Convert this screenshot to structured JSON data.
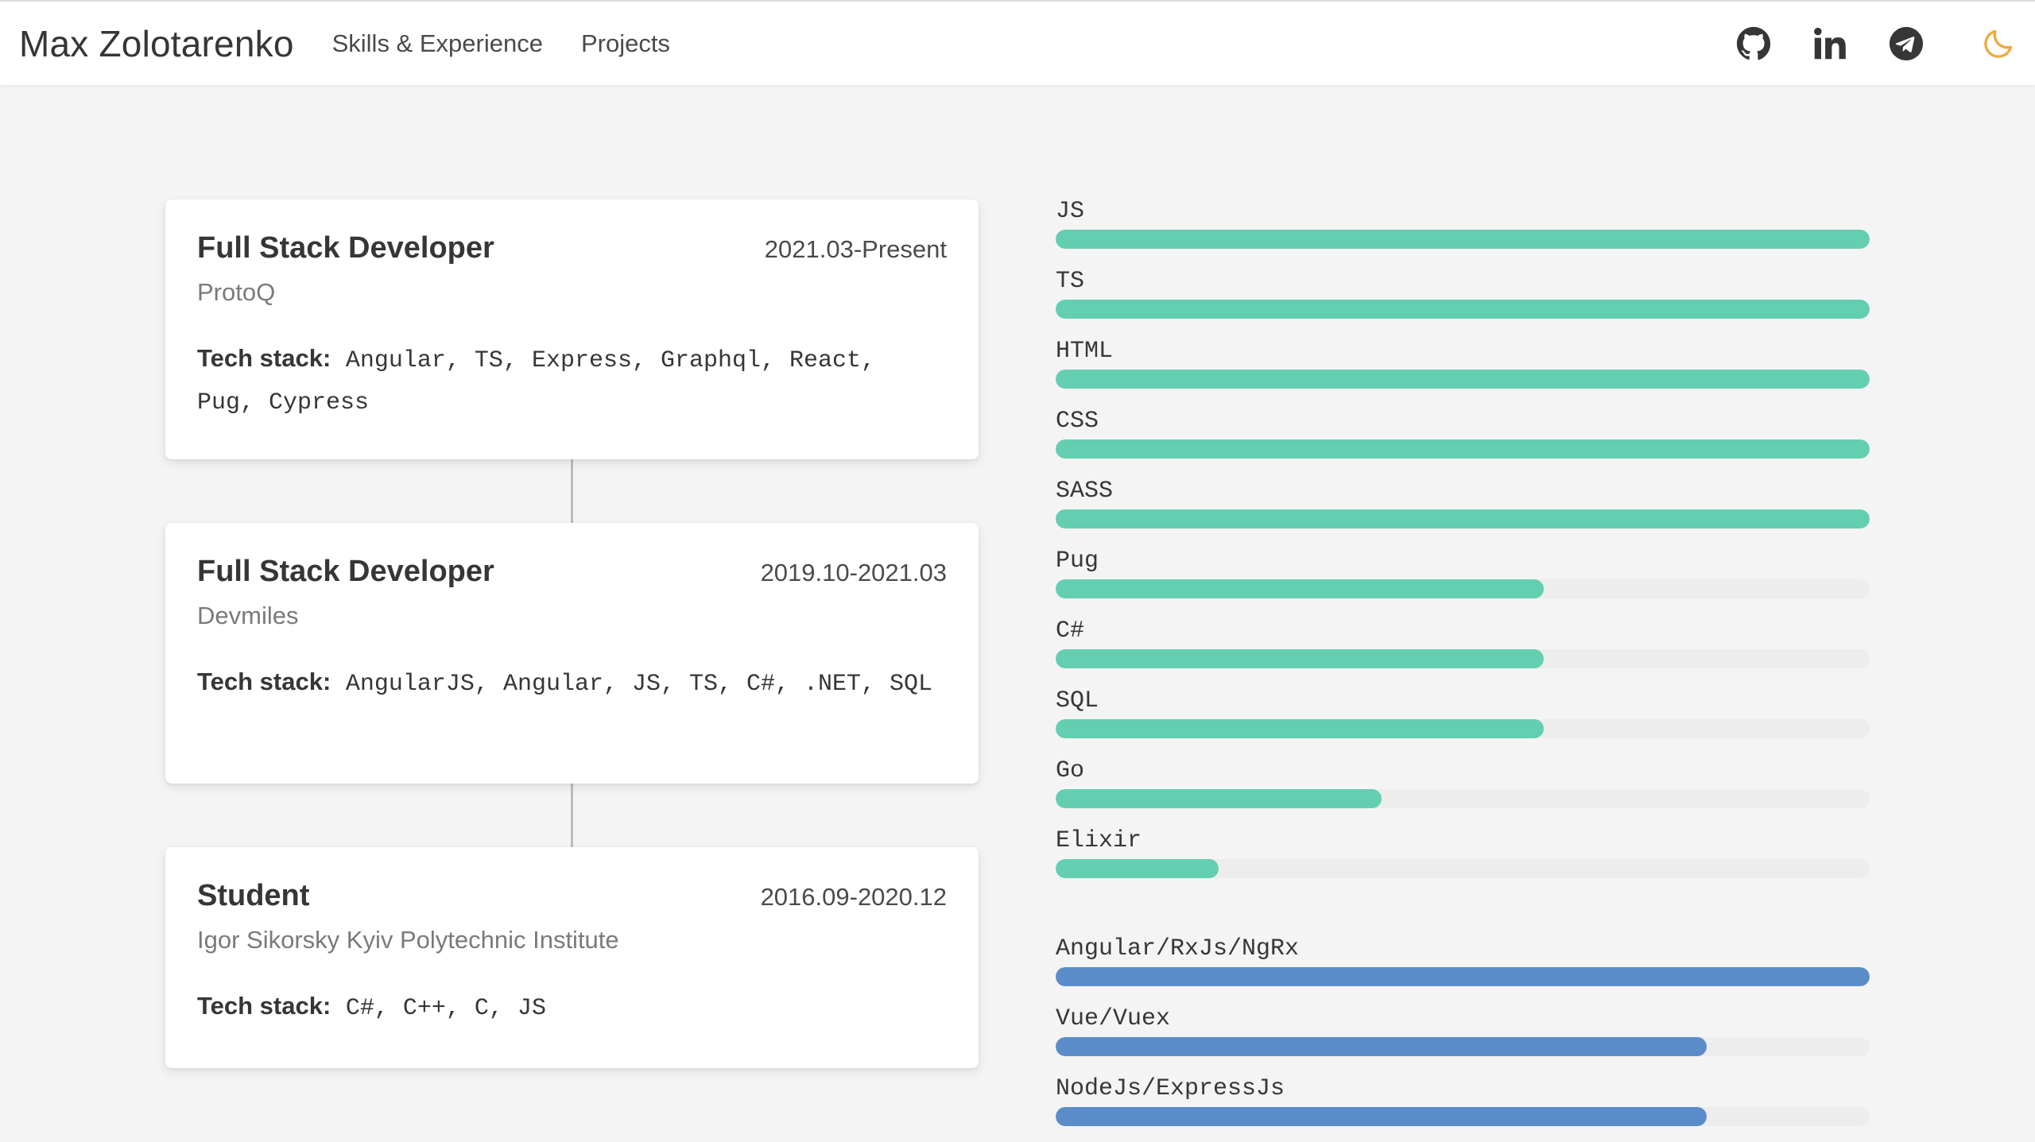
{
  "nav": {
    "brand": "Max Zolotarenko",
    "links": [
      "Skills & Experience",
      "Projects"
    ],
    "icons": [
      "github-icon",
      "linkedin-icon",
      "telegram-icon",
      "moon-icon"
    ],
    "theme_icon_color": "#f0a93b"
  },
  "experience": [
    {
      "title": "Full Stack Developer",
      "date": "2021.03-Present",
      "company": "ProtoQ",
      "stack_label": "Tech stack:",
      "stack": "Angular, TS, Express, Graphql, React, Pug, Cypress"
    },
    {
      "title": "Full Stack Developer",
      "date": "2019.10-2021.03",
      "company": "Devmiles",
      "stack_label": "Tech stack:",
      "stack": "AngularJS, Angular, JS, TS, C#, .NET, SQL"
    },
    {
      "title": "Student",
      "date": "2016.09-2020.12",
      "company": "Igor Sikorsky Kyiv Polytechnic Institute",
      "stack_label": "Tech stack:",
      "stack": "C#, C++, C, JS"
    }
  ],
  "colors": {
    "language_bar": "#63cfb0",
    "framework_bar": "#5a8cca",
    "bar_track": "#ededed"
  },
  "skills": {
    "languages": [
      {
        "name": "JS",
        "level": 1.0
      },
      {
        "name": "TS",
        "level": 1.0
      },
      {
        "name": "HTML",
        "level": 1.0
      },
      {
        "name": "CSS",
        "level": 1.0
      },
      {
        "name": "SASS",
        "level": 1.0
      },
      {
        "name": "Pug",
        "level": 0.6
      },
      {
        "name": "C#",
        "level": 0.6
      },
      {
        "name": "SQL",
        "level": 0.6
      },
      {
        "name": "Go",
        "level": 0.4
      },
      {
        "name": "Elixir",
        "level": 0.2
      }
    ],
    "frameworks": [
      {
        "name": "Angular/RxJs/NgRx",
        "level": 1.0
      },
      {
        "name": "Vue/Vuex",
        "level": 0.8
      },
      {
        "name": "NodeJs/ExpressJs",
        "level": 0.8
      }
    ]
  }
}
